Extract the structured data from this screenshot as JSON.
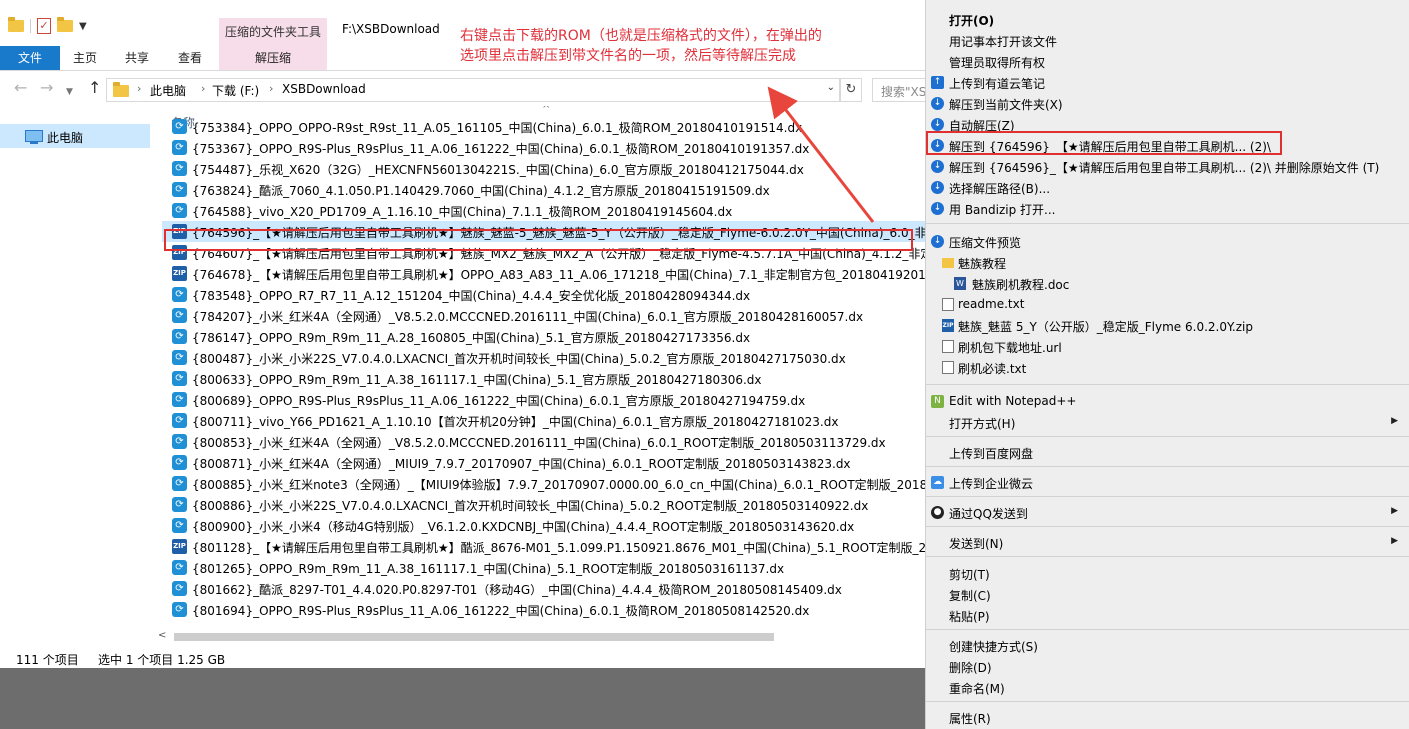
{
  "explorer": {
    "ribbon": {
      "context_tab_header": "压缩的文件夹工具",
      "window_title": "F:\\XSBDownload",
      "tabs": [
        "文件",
        "主页",
        "共享",
        "查看",
        "解压缩"
      ]
    },
    "address": {
      "crumbs": [
        "此电脑",
        "下载 (F:)",
        "XSBDownload"
      ],
      "search_placeholder": "搜索\"XS"
    },
    "nav": {
      "this_pc": "此电脑"
    },
    "columns": {
      "name": "名称"
    },
    "files": [
      {
        "name": "{753384}_OPPO_OPPO-R9st_R9st_11_A.05_161105_中国(China)_6.0.1_极简ROM_20180410191514.dx",
        "type": "dx"
      },
      {
        "name": "{753367}_OPPO_R9S-Plus_R9sPlus_11_A.06_161222_中国(China)_6.0.1_极简ROM_20180410191357.dx",
        "type": "dx"
      },
      {
        "name": "{754487}_乐视_X620（32G）_HEXCNFN5601304221S._中国(China)_6.0_官方原版_20180412175044.dx",
        "type": "dx"
      },
      {
        "name": "{763824}_酷派_7060_4.1.050.P1.140429.7060_中国(China)_4.1.2_官方原版_20180415191509.dx",
        "type": "dx"
      },
      {
        "name": "{764588}_vivo_X20_PD1709_A_1.16.10_中国(China)_7.1.1_极简ROM_20180419145604.dx",
        "type": "dx"
      },
      {
        "name": "{764596}_【★请解压后用包里自带工具刷机★】魅族_魅蓝-5_魅族_魅蓝-5_Y（公开版）_稳定版_Flyme-6.0.2.0Y_中国(China)_6.0_非定...",
        "type": "zip",
        "selected": true
      },
      {
        "name": "{764607}_【★请解压后用包里自带工具刷机★】魅族_MX2_魅族_MX2_A（公开版）_稳定版_Flyme-4.5.7.1A_中国(China)_4.1.2_非定制...",
        "type": "zip"
      },
      {
        "name": "{764678}_【★请解压后用包里自带工具刷机★】OPPO_A83_A83_11_A.06_171218_中国(China)_7.1_非定制官方包_20180419201652.z",
        "type": "zip"
      },
      {
        "name": "{783548}_OPPO_R7_R7_11_A.12_151204_中国(China)_4.4.4_安全优化版_20180428094344.dx",
        "type": "dx"
      },
      {
        "name": "{784207}_小米_红米4A（全网通）_V8.5.2.0.MCCCNED.2016111_中国(China)_6.0.1_官方原版_20180428160057.dx",
        "type": "dx"
      },
      {
        "name": "{786147}_OPPO_R9m_R9m_11_A.28_160805_中国(China)_5.1_官方原版_20180427173356.dx",
        "type": "dx"
      },
      {
        "name": "{800487}_小米_小米22S_V7.0.4.0.LXACNCI_首次开机时间较长_中国(China)_5.0.2_官方原版_20180427175030.dx",
        "type": "dx"
      },
      {
        "name": "{800633}_OPPO_R9m_R9m_11_A.38_161117.1_中国(China)_5.1_官方原版_20180427180306.dx",
        "type": "dx"
      },
      {
        "name": "{800689}_OPPO_R9S-Plus_R9sPlus_11_A.06_161222_中国(China)_6.0.1_官方原版_20180427194759.dx",
        "type": "dx"
      },
      {
        "name": "{800711}_vivo_Y66_PD1621_A_1.10.10【首次开机20分钟】_中国(China)_6.0.1_官方原版_20180427181023.dx",
        "type": "dx"
      },
      {
        "name": "{800853}_小米_红米4A（全网通）_V8.5.2.0.MCCCNED.2016111_中国(China)_6.0.1_ROOT定制版_20180503113729.dx",
        "type": "dx"
      },
      {
        "name": "{800871}_小米_红米4A（全网通）_MIUI9_7.9.7_20170907_中国(China)_6.0.1_ROOT定制版_20180503143823.dx",
        "type": "dx"
      },
      {
        "name": "{800885}_小米_红米note3（全网通）_【MIUI9体验版】7.9.7_20170907.0000.00_6.0_cn_中国(China)_6.0.1_ROOT定制版_20180503...",
        "type": "dx"
      },
      {
        "name": "{800886}_小米_小米22S_V7.0.4.0.LXACNCI_首次开机时间较长_中国(China)_5.0.2_ROOT定制版_20180503140922.dx",
        "type": "dx"
      },
      {
        "name": "{800900}_小米_小米4（移动4G特别版）_V6.1.2.0.KXDCNBJ_中国(China)_4.4.4_ROOT定制版_20180503143620.dx",
        "type": "dx"
      },
      {
        "name": "{801128}_【★请解压后用包里自带工具刷机★】酷派_8676-M01_5.1.099.P1.150921.8676_M01_中国(China)_5.1_ROOT定制版_2018...",
        "type": "zip"
      },
      {
        "name": "{801265}_OPPO_R9m_R9m_11_A.38_161117.1_中国(China)_5.1_ROOT定制版_20180503161137.dx",
        "type": "dx"
      },
      {
        "name": "{801662}_酷派_8297-T01_4.4.020.P0.8297-T01（移动4G）_中国(China)_4.4.4_极简ROM_20180508145409.dx",
        "type": "dx"
      },
      {
        "name": "{801694}_OPPO_R9S-Plus_R9sPlus_11_A.06_161222_中国(China)_6.0.1_极简ROM_20180508142520.dx",
        "type": "dx"
      }
    ],
    "status": {
      "count": "111 个项目",
      "selected": "选中 1 个项目  1.25 GB"
    },
    "annotation": {
      "line1": "右键点击下载的ROM（也就是压缩格式的文件），在弹出的",
      "line2": "选项里点击解压到带文件名的一项，然后等待解压完成",
      "color": "#e0303a"
    }
  },
  "context_menu": {
    "open": "打开(O)",
    "open_notepad": "用记事本打开该文件",
    "admin_own": "管理员取得所有权",
    "upload_youdao": "上传到有道云笔记",
    "extract_here": "解压到当前文件夹(X)",
    "auto_extract": "自动解压(Z)",
    "extract_to_folder": "解压到 {764596}_【★请解压后用包里自带工具刷机... (2)\\",
    "extract_delete": "解压到 {764596}_【★请解压后用包里自带工具刷机... (2)\\ 并删除原始文件 (T)",
    "choose_path": "选择解压路径(B)...",
    "bandizip_open": "用 Bandizip 打开...",
    "preview": "压缩文件预览",
    "preview_items": [
      {
        "label": "魅族教程",
        "icon": "folder-icon"
      },
      {
        "label": "魅族刷机教程.doc",
        "icon": "word-doc-icon"
      },
      {
        "label": "readme.txt",
        "icon": "text-file-icon"
      },
      {
        "label": "魅族_魅蓝 5_Y（公开版）_稳定版_Flyme 6.0.2.0Y.zip",
        "icon": "zip-file-icon"
      },
      {
        "label": "刷机包下载地址.url",
        "icon": "url-file-icon"
      },
      {
        "label": "刷机必读.txt",
        "icon": "text-file-icon"
      }
    ],
    "notepadpp": "Edit with Notepad++",
    "open_with": "打开方式(H)",
    "upload_baidu": "上传到百度网盘",
    "upload_wework": "上传到企业微云",
    "send_qq": "通过QQ发送到",
    "send_to": "发送到(N)",
    "cut": "剪切(T)",
    "copy": "复制(C)",
    "paste": "粘贴(P)",
    "create_shortcut": "创建快捷方式(S)",
    "delete": "删除(D)",
    "rename": "重命名(M)",
    "properties": "属性(R)"
  },
  "colors": {
    "accent": "#1979ca",
    "selection": "#cce8ff",
    "highlight_box": "#e03030",
    "context_tab": "#f7dde9"
  }
}
